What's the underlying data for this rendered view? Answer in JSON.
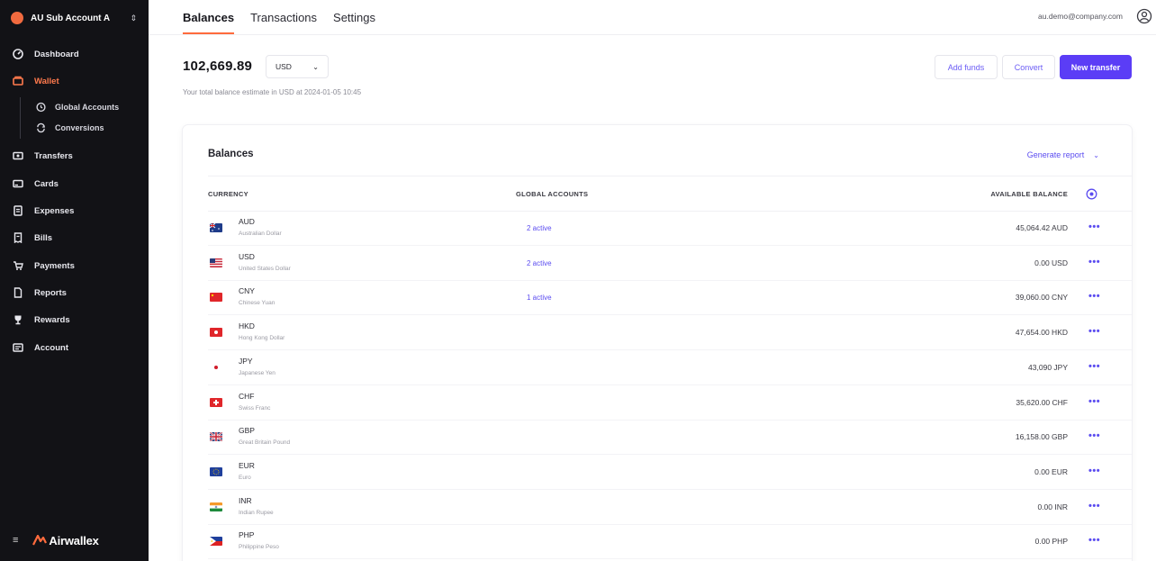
{
  "sidebar": {
    "account_name": "AU Sub Account A",
    "items": [
      {
        "label": "Dashboard",
        "icon": "dashboard-icon"
      },
      {
        "label": "Wallet",
        "icon": "wallet-icon",
        "active": true
      },
      {
        "label": "Transfers",
        "icon": "transfers-icon"
      },
      {
        "label": "Cards",
        "icon": "cards-icon"
      },
      {
        "label": "Expenses",
        "icon": "expenses-icon"
      },
      {
        "label": "Bills",
        "icon": "bills-icon"
      },
      {
        "label": "Payments",
        "icon": "payments-icon"
      },
      {
        "label": "Reports",
        "icon": "reports-icon"
      },
      {
        "label": "Rewards",
        "icon": "rewards-icon"
      },
      {
        "label": "Account",
        "icon": "account-icon"
      }
    ],
    "sub_items": [
      {
        "label": "Global Accounts",
        "icon": "globe-icon"
      },
      {
        "label": "Conversions",
        "icon": "conversions-icon"
      }
    ],
    "logo_text": "Airwallex"
  },
  "header": {
    "tabs": [
      {
        "label": "Balances",
        "active": true
      },
      {
        "label": "Transactions"
      },
      {
        "label": "Settings"
      }
    ],
    "user_email": "au.demo@company.com"
  },
  "summary": {
    "total": "102,669.89",
    "currency": "USD",
    "estimate": "Your total balance estimate in USD at 2024-01-05 10:45"
  },
  "actions": {
    "add_funds": "Add funds",
    "convert": "Convert",
    "new_transfer": "New transfer"
  },
  "balances": {
    "title": "Balances",
    "generate_report": "Generate report",
    "columns": {
      "currency": "CURRENCY",
      "global_accounts": "GLOBAL ACCOUNTS",
      "available_balance": "AVAILABLE BALANCE"
    },
    "rows": [
      {
        "code": "AUD",
        "name": "Australian Dollar",
        "global": "2 active",
        "amount": "45,064.42 AUD",
        "flag": "au"
      },
      {
        "code": "USD",
        "name": "United States Dollar",
        "global": "2 active",
        "amount": "0.00 USD",
        "flag": "us"
      },
      {
        "code": "CNY",
        "name": "Chinese Yuan",
        "global": "1 active",
        "amount": "39,060.00 CNY",
        "flag": "cn"
      },
      {
        "code": "HKD",
        "name": "Hong Kong Dollar",
        "global": "",
        "amount": "47,654.00 HKD",
        "flag": "hk"
      },
      {
        "code": "JPY",
        "name": "Japanese Yen",
        "global": "",
        "amount": "43,090 JPY",
        "flag": "jp"
      },
      {
        "code": "CHF",
        "name": "Swiss Franc",
        "global": "",
        "amount": "35,620.00 CHF",
        "flag": "ch"
      },
      {
        "code": "GBP",
        "name": "Great Britain Pound",
        "global": "",
        "amount": "16,158.00 GBP",
        "flag": "gb"
      },
      {
        "code": "EUR",
        "name": "Euro",
        "global": "",
        "amount": "0.00 EUR",
        "flag": "eu"
      },
      {
        "code": "INR",
        "name": "Indian Rupee",
        "global": "",
        "amount": "0.00 INR",
        "flag": "in"
      },
      {
        "code": "PHP",
        "name": "Philippine Peso",
        "global": "",
        "amount": "0.00 PHP",
        "flag": "ph"
      }
    ]
  }
}
